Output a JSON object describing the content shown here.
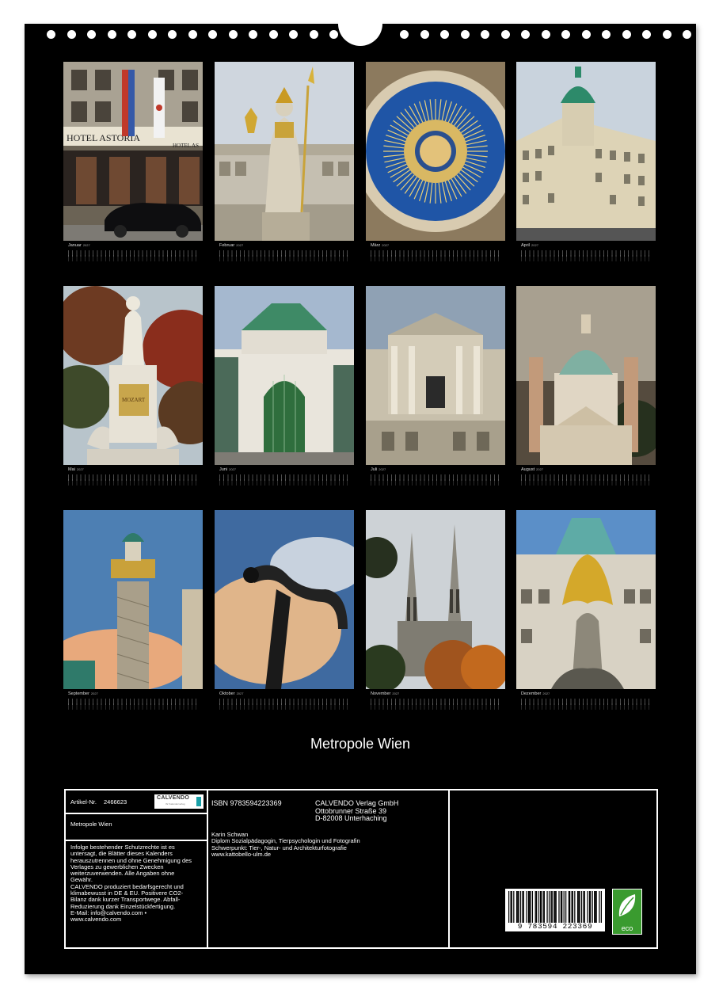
{
  "months": [
    {
      "label": "Januar",
      "year": "2027"
    },
    {
      "label": "Februar",
      "year": "2027"
    },
    {
      "label": "März",
      "year": "2027"
    },
    {
      "label": "April",
      "year": "2027"
    },
    {
      "label": "Mai",
      "year": "2027"
    },
    {
      "label": "Juni",
      "year": "2027"
    },
    {
      "label": "Juli",
      "year": "2027"
    },
    {
      "label": "August",
      "year": "2027"
    },
    {
      "label": "September",
      "year": "2027"
    },
    {
      "label": "Oktober",
      "year": "2027"
    },
    {
      "label": "November",
      "year": "2027"
    },
    {
      "label": "Dezember",
      "year": "2027"
    }
  ],
  "photo_signs": {
    "hotel_sign": "HOTEL ASTORIA",
    "hotel_sign_2": "HOTEL AS",
    "mozart_plaque": "MOZART"
  },
  "calendar_title": "Metropole Wien",
  "info": {
    "article_label": "Artikel-Nr.",
    "article_number": "2466623",
    "logo_text": "CALVENDO",
    "logo_sub": "Ihr Kalenderverlag",
    "product_title": "Metropole Wien",
    "legal_lines": [
      "Infolge bestehender Schutzrechte ist es",
      "untersagt, die Blätter dieses Kalenders",
      "herauszutrennen und ohne Genehmigung des",
      "Verlages zu gewerblichen Zwecken",
      "weiterzuverwenden. Alle Angaben ohne",
      "Gewähr.",
      "CALVENDO produziert bedarfsgerecht und",
      "klimabewusst in DE & EU. Positivere CO2-",
      "Bilanz dank kurzer Transportwege. Abfall-",
      "Reduzierung dank Einzelstückfertigung.",
      "E-Mail: info@calvendo.com •",
      "www.calvendo.com"
    ],
    "isbn": "ISBN 9783594223369",
    "publisher_lines": [
      "CALVENDO Verlag GmbH",
      "Ottobrunner Straße 39",
      "D-82008 Unterhaching"
    ],
    "author_lines": [
      "Karin Schwan",
      "Diplom Sozialpädagogin, Tierpsychologin und Fotografin",
      "Schwerpunkt: Tier-, Natur- und Architekturfotografie",
      "www.kattobello-ulm.de"
    ],
    "barcode_digits": "9 783594 223369",
    "eco_label": "eco"
  },
  "colors": {
    "sheet": "#000000",
    "text": "#ffffff",
    "eco_green": "#3a9b2f"
  }
}
